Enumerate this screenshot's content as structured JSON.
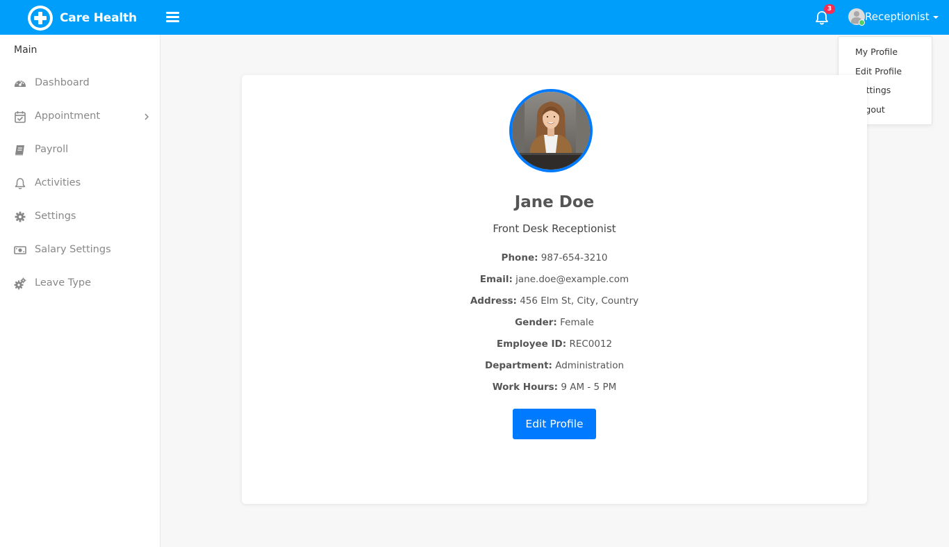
{
  "header": {
    "brand_name": "Care Health",
    "notification_count": "3",
    "user_role": "Receptionist",
    "accent_color": "#009efb"
  },
  "user_dropdown": {
    "items": [
      {
        "label": "My Profile"
      },
      {
        "label": "Edit Profile"
      },
      {
        "label": "Settings"
      },
      {
        "label": "Logout"
      }
    ]
  },
  "sidebar": {
    "title": "Main",
    "items": [
      {
        "label": "Dashboard",
        "icon": "dashboard-gauge-icon"
      },
      {
        "label": "Appointment",
        "icon": "calendar-check-icon",
        "has_submenu": true
      },
      {
        "label": "Payroll",
        "icon": "book-icon"
      },
      {
        "label": "Activities",
        "icon": "bell-icon"
      },
      {
        "label": "Settings",
        "icon": "gear-icon"
      },
      {
        "label": "Salary Settings",
        "icon": "money-bill-icon"
      },
      {
        "label": "Leave Type",
        "icon": "gears-icon"
      }
    ]
  },
  "profile": {
    "name": "Jane Doe",
    "title": "Front Desk Receptionist",
    "fields": [
      {
        "label": "Phone:",
        "value": "987-654-3210"
      },
      {
        "label": "Email:",
        "value": "jane.doe@example.com"
      },
      {
        "label": "Address:",
        "value": "456 Elm St, City, Country"
      },
      {
        "label": "Gender:",
        "value": "Female"
      },
      {
        "label": "Employee ID:",
        "value": "REC0012"
      },
      {
        "label": "Department:",
        "value": "Administration"
      },
      {
        "label": "Work Hours:",
        "value": "9 AM - 5 PM"
      }
    ],
    "edit_button_label": "Edit Profile",
    "button_color": "#007bff"
  }
}
